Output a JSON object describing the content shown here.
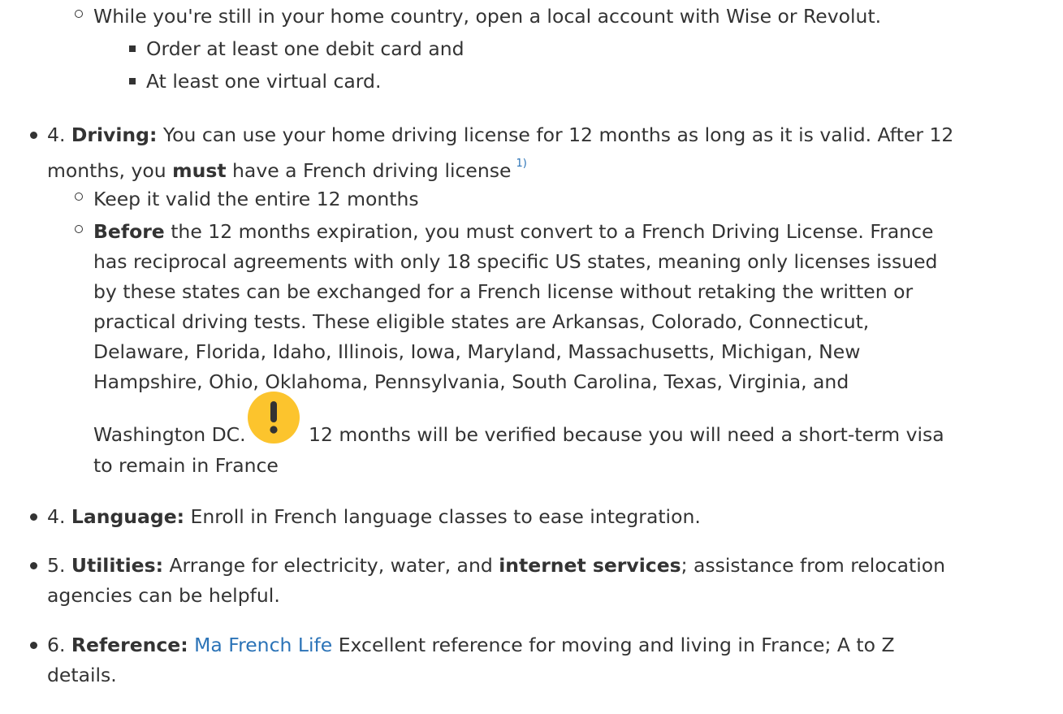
{
  "intro": {
    "wise_line": "While you're still in your home country, open a local account with Wise or Revolut.",
    "card_debit": "Order at least one debit card and",
    "card_virtual": "At least one virtual card."
  },
  "driving": {
    "number": "4.",
    "heading": "Driving:",
    "text_a": " You can use your home driving license for 12 months as long as it is valid. After 12",
    "text_b1": "months, you ",
    "must": "must",
    "text_b2": " have a French driving license",
    "footnote": "1)",
    "sub1": "Keep it valid the entire 12 months",
    "before": "Before",
    "sub2_l1": " the 12 months expiration, you must convert to a French Driving License. France",
    "sub2_l2": "has reciprocal agreements with only 18 specific US states, meaning only licenses issued",
    "sub2_l3": "by these states can be exchanged for a French license without retaking the written or",
    "sub2_l4": "practical driving tests. These eligible states are Arkansas, Colorado, Connecticut,",
    "sub2_l5": "Delaware, Florida, Idaho, Illinois, Iowa, Maryland, Massachusetts, Michigan, New",
    "sub2_l6": "Hampshire, Ohio, Oklahoma, Pennsylvania, South Carolina, Texas, Virginia, and",
    "sub2_l7a": "Washington DC.",
    "sub2_l7b": "12 months will be verified because you will need a short-term visa",
    "sub2_l8": "to remain in France",
    "warning_icon_color": "#fcc42d"
  },
  "language": {
    "number": "4.",
    "heading": "Language:",
    "text": " Enroll in French language classes to ease integration."
  },
  "utilities": {
    "number": "5.",
    "heading": "Utilities:",
    "text_a": " Arrange for electricity, water, and ",
    "bold": "internet services",
    "text_b": "; assistance from relocation",
    "text_c": "agencies can be helpful."
  },
  "reference": {
    "number": "6.",
    "heading": "Reference:",
    "link": "Ma French Life",
    "text_a": " Excellent reference for moving and living in France; A to Z",
    "text_b": "details."
  },
  "colors": {
    "text": "#333333",
    "link": "#2b73b7",
    "warning": "#fcc42d"
  }
}
